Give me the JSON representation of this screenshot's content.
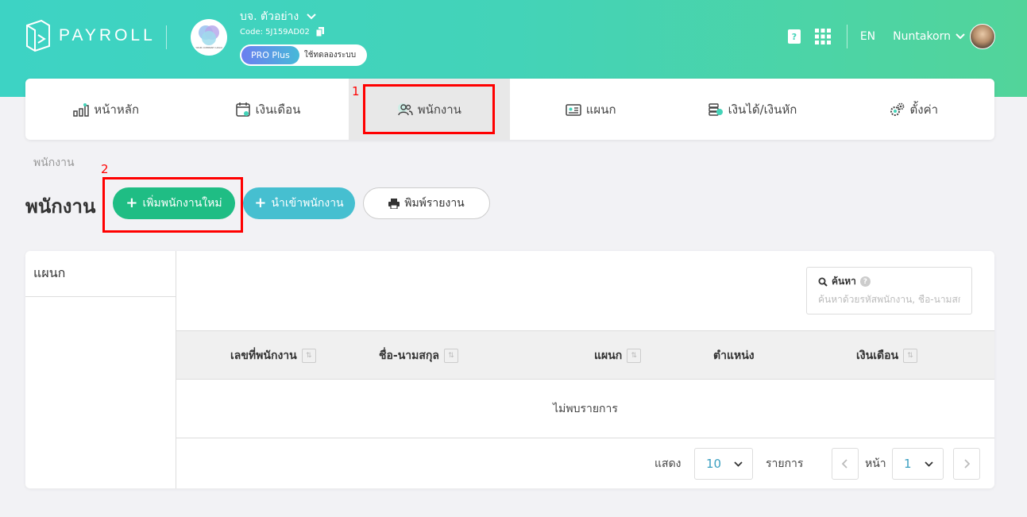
{
  "app": {
    "brand": "PAYROLL"
  },
  "company": {
    "name": "บจ. ตัวอย่าง",
    "code": "Code: 5J159AD02",
    "logo_text": "YOUR COMPANY LOGO",
    "plan_badge": "PRO Plus",
    "plan_status": "ใช้ทดลองระบบ"
  },
  "header": {
    "language": "EN",
    "user_name": "Nuntakorn"
  },
  "nav": {
    "items": [
      {
        "label": "หน้าหลัก",
        "icon": "chart-bars-icon"
      },
      {
        "label": "เงินเดือน",
        "icon": "calendar-icon"
      },
      {
        "label": "พนักงาน",
        "icon": "users-icon",
        "active": true
      },
      {
        "label": "แผนก",
        "icon": "id-card-icon"
      },
      {
        "label": "เงินได้/เงินหัก",
        "icon": "money-stack-icon"
      },
      {
        "label": "ตั้งค่า",
        "icon": "gears-icon"
      }
    ]
  },
  "annotations": {
    "first": "1",
    "second": "2",
    "color": "#ff0000"
  },
  "breadcrumb": "พนักงาน",
  "page": {
    "title": "พนักงาน"
  },
  "actions": {
    "add_employee": "เพิ่มพนักงานใหม่",
    "import_employee": "นำเข้าพนักงาน",
    "print_report": "พิมพ์รายงาน"
  },
  "sidebar": {
    "title": "แผนก"
  },
  "search": {
    "label": "ค้นหา",
    "placeholder": "ค้นหาด้วยรหัสพนักงาน, ชื่อ-นามสกุล"
  },
  "table": {
    "columns": [
      "เลขที่พนักงาน",
      "ชื่อ-นามสกุล",
      "แผนก",
      "ตำแหน่ง",
      "เงินเดือน"
    ],
    "empty_text": "ไม่พบรายการ"
  },
  "pagination": {
    "show_label": "แสดง",
    "page_size": "10",
    "rows_label": "รายการ",
    "page_label": "หน้า",
    "current_page": "1"
  },
  "colors": {
    "header_gradient_start": "#3dd3c4",
    "header_gradient_end": "#52d49a",
    "add_button": "#1fbd84",
    "import_button": "#46bfd0"
  }
}
